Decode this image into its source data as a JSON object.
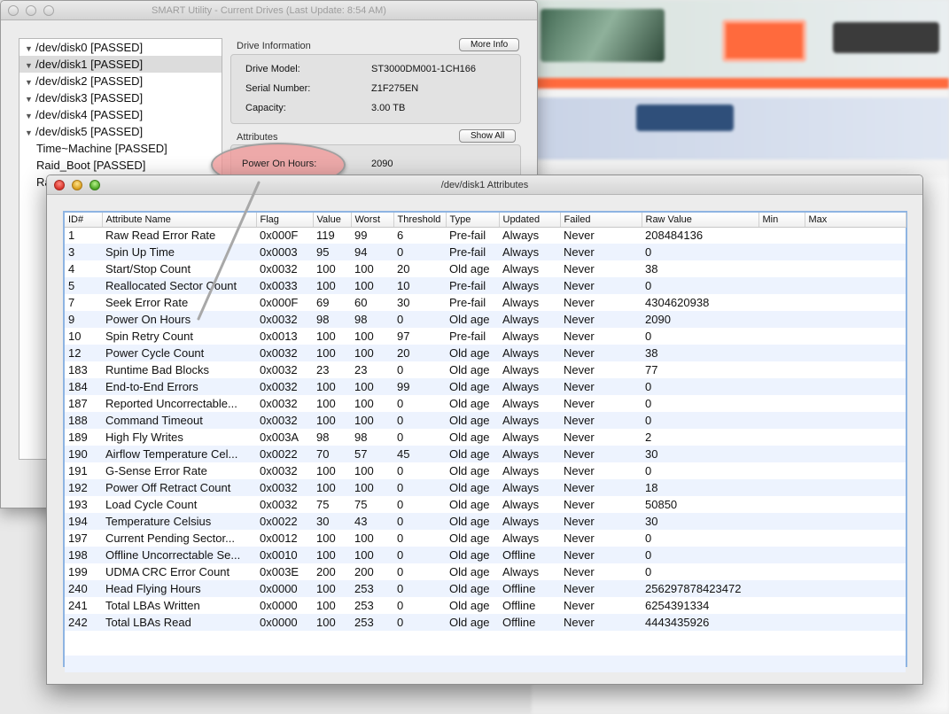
{
  "main_window": {
    "title": "SMART Utility - Current Drives (Last Update: 8:54 AM)",
    "drives": [
      {
        "label": "/dev/disk0  [PASSED]",
        "expandable": true
      },
      {
        "label": "/dev/disk1  [PASSED]",
        "expandable": true,
        "selected": true
      },
      {
        "label": "/dev/disk2  [PASSED]",
        "expandable": true
      },
      {
        "label": "/dev/disk3  [PASSED]",
        "expandable": true
      },
      {
        "label": "/dev/disk4  [PASSED]",
        "expandable": true
      },
      {
        "label": "/dev/disk5  [PASSED]",
        "expandable": true
      },
      {
        "label": "Time~Machine  [PASSED]",
        "expandable": false
      },
      {
        "label": "Raid_Boot  [PASSED]",
        "expandable": false
      },
      {
        "label": "Ra",
        "expandable": false
      }
    ],
    "drive_info": {
      "section_label": "Drive Information",
      "more_info_button": "More Info",
      "rows": [
        {
          "label": "Drive Model:",
          "value": "ST3000DM001-1CH166"
        },
        {
          "label": "Serial Number:",
          "value": "Z1F275EN"
        },
        {
          "label": "Capacity:",
          "value": "3.00 TB"
        }
      ]
    },
    "attributes": {
      "section_label": "Attributes",
      "show_all_button": "Show All",
      "highlight_label": "Power On Hours:",
      "highlight_value": "2090"
    }
  },
  "attr_window": {
    "title": "/dev/disk1 Attributes",
    "columns": [
      "ID#",
      "Attribute Name",
      "Flag",
      "Value",
      "Worst",
      "Threshold",
      "Type",
      "Updated",
      "Failed",
      "Raw Value",
      "Min",
      "Max"
    ],
    "rows": [
      [
        "1",
        "Raw Read Error Rate",
        "0x000F",
        "119",
        "99",
        "6",
        "Pre-fail",
        "Always",
        "Never",
        "208484136",
        "",
        ""
      ],
      [
        "3",
        "Spin Up Time",
        "0x0003",
        "95",
        "94",
        "0",
        "Pre-fail",
        "Always",
        "Never",
        "0",
        "",
        ""
      ],
      [
        "4",
        "Start/Stop Count",
        "0x0032",
        "100",
        "100",
        "20",
        "Old age",
        "Always",
        "Never",
        "38",
        "",
        ""
      ],
      [
        "5",
        "Reallocated Sector Count",
        "0x0033",
        "100",
        "100",
        "10",
        "Pre-fail",
        "Always",
        "Never",
        "0",
        "",
        ""
      ],
      [
        "7",
        "Seek Error Rate",
        "0x000F",
        "69",
        "60",
        "30",
        "Pre-fail",
        "Always",
        "Never",
        "4304620938",
        "",
        ""
      ],
      [
        "9",
        "Power On Hours",
        "0x0032",
        "98",
        "98",
        "0",
        "Old age",
        "Always",
        "Never",
        "2090",
        "",
        ""
      ],
      [
        "10",
        "Spin Retry Count",
        "0x0013",
        "100",
        "100",
        "97",
        "Pre-fail",
        "Always",
        "Never",
        "0",
        "",
        ""
      ],
      [
        "12",
        "Power Cycle Count",
        "0x0032",
        "100",
        "100",
        "20",
        "Old age",
        "Always",
        "Never",
        "38",
        "",
        ""
      ],
      [
        "183",
        "Runtime Bad Blocks",
        "0x0032",
        "23",
        "23",
        "0",
        "Old age",
        "Always",
        "Never",
        "77",
        "",
        ""
      ],
      [
        "184",
        "End-to-End Errors",
        "0x0032",
        "100",
        "100",
        "99",
        "Old age",
        "Always",
        "Never",
        "0",
        "",
        ""
      ],
      [
        "187",
        "Reported Uncorrectable...",
        "0x0032",
        "100",
        "100",
        "0",
        "Old age",
        "Always",
        "Never",
        "0",
        "",
        ""
      ],
      [
        "188",
        "Command Timeout",
        "0x0032",
        "100",
        "100",
        "0",
        "Old age",
        "Always",
        "Never",
        "0",
        "",
        ""
      ],
      [
        "189",
        "High Fly Writes",
        "0x003A",
        "98",
        "98",
        "0",
        "Old age",
        "Always",
        "Never",
        "2",
        "",
        ""
      ],
      [
        "190",
        "Airflow Temperature Cel...",
        "0x0022",
        "70",
        "57",
        "45",
        "Old age",
        "Always",
        "Never",
        "30",
        "",
        ""
      ],
      [
        "191",
        "G-Sense Error Rate",
        "0x0032",
        "100",
        "100",
        "0",
        "Old age",
        "Always",
        "Never",
        "0",
        "",
        ""
      ],
      [
        "192",
        "Power Off Retract Count",
        "0x0032",
        "100",
        "100",
        "0",
        "Old age",
        "Always",
        "Never",
        "18",
        "",
        ""
      ],
      [
        "193",
        "Load Cycle Count",
        "0x0032",
        "75",
        "75",
        "0",
        "Old age",
        "Always",
        "Never",
        "50850",
        "",
        ""
      ],
      [
        "194",
        "Temperature Celsius",
        "0x0022",
        "30",
        "43",
        "0",
        "Old age",
        "Always",
        "Never",
        "30",
        "",
        ""
      ],
      [
        "197",
        "Current Pending Sector...",
        "0x0012",
        "100",
        "100",
        "0",
        "Old age",
        "Always",
        "Never",
        "0",
        "",
        ""
      ],
      [
        "198",
        "Offline Uncorrectable Se...",
        "0x0010",
        "100",
        "100",
        "0",
        "Old age",
        "Offline",
        "Never",
        "0",
        "",
        ""
      ],
      [
        "199",
        "UDMA CRC Error Count",
        "0x003E",
        "200",
        "200",
        "0",
        "Old age",
        "Always",
        "Never",
        "0",
        "",
        ""
      ],
      [
        "240",
        "Head Flying Hours",
        "0x0000",
        "100",
        "253",
        "0",
        "Old age",
        "Offline",
        "Never",
        "256297878423472",
        "",
        ""
      ],
      [
        "241",
        "Total LBAs Written",
        "0x0000",
        "100",
        "253",
        "0",
        "Old age",
        "Offline",
        "Never",
        "6254391334",
        "",
        ""
      ],
      [
        "242",
        "Total LBAs Read",
        "0x0000",
        "100",
        "253",
        "0",
        "Old age",
        "Offline",
        "Never",
        "4443435926",
        "",
        ""
      ]
    ]
  },
  "colors": {
    "selection_gray": "#dcdcdc",
    "alt_row": "#edf3fe",
    "focus_ring": "#8eb4e2",
    "callout_pink": "#f09696"
  }
}
